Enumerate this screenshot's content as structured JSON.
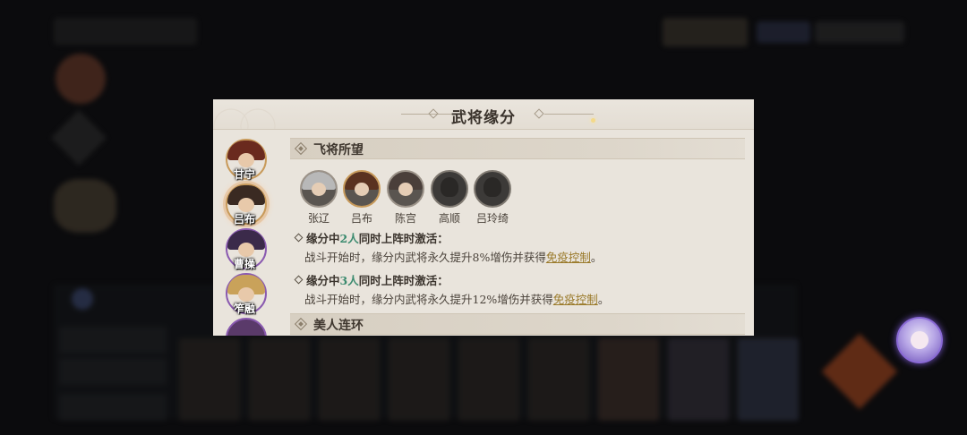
{
  "dialog": {
    "title": "武将缘分",
    "heroes": [
      {
        "name": "甘宁",
        "hair": "#6a2a1e",
        "selected": false
      },
      {
        "name": "吕布",
        "hair": "#3a2a22",
        "selected": true
      },
      {
        "name": "曹操",
        "hair": "#3b2a4a",
        "selected": false
      },
      {
        "name": "笮融",
        "hair": "#c9a25a",
        "selected": false
      }
    ],
    "section_1": {
      "title": "飞将所望",
      "members": [
        {
          "name": "张辽",
          "owned": true,
          "hair": "#b8b8b8"
        },
        {
          "name": "吕布",
          "owned": true,
          "hair": "#5a3220"
        },
        {
          "name": "陈宫",
          "owned": true,
          "hair": "#4a3f3a"
        },
        {
          "name": "高顺",
          "owned": false
        },
        {
          "name": "吕玲绮",
          "owned": false
        }
      ],
      "bonds": [
        {
          "prefix": "缘分中",
          "count": "2人",
          "suffix": "同时上阵时激活：",
          "desc_before": "战斗开始时，缘分内武将永久提升8%增伤并获得",
          "keyword": "免疫控制",
          "desc_after": "。"
        },
        {
          "prefix": "缘分中",
          "count": "3人",
          "suffix": "同时上阵时激活：",
          "desc_before": "战斗开始时，缘分内武将永久提升12%增伤并获得",
          "keyword": "免疫控制",
          "desc_after": "。"
        }
      ]
    },
    "section_2": {
      "title": "美人连环"
    }
  },
  "colors": {
    "dialog_bg": "#e9e4dc",
    "accent_count": "#3a8a6e",
    "keyword": "#9a7a2a"
  }
}
